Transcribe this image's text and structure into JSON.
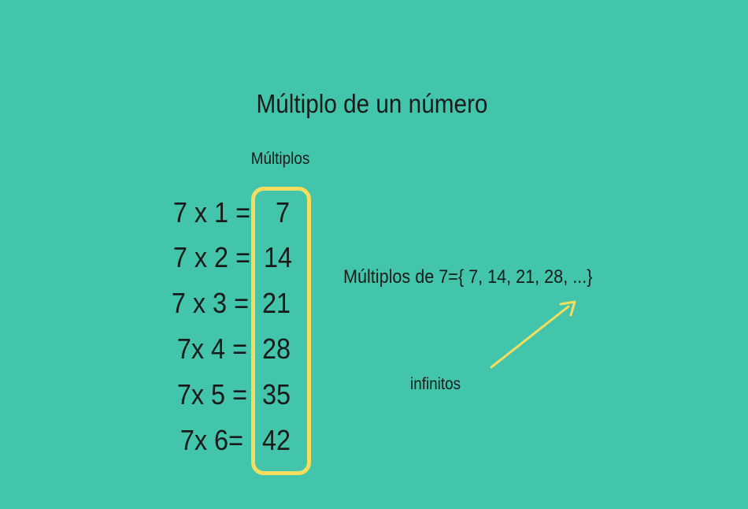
{
  "title": "Múltiplo de un número",
  "column_label": "Múltiplos",
  "rows": [
    {
      "expr": "7 x 1 =",
      "result": "7"
    },
    {
      "expr": "7 x 2 =",
      "result": "14"
    },
    {
      "expr": "7 x 3 =",
      "result": "21"
    },
    {
      "expr": "7x 4 =",
      "result": "28"
    },
    {
      "expr": "7x 5 =",
      "result": "35"
    },
    {
      "expr": "7x 6=",
      "result": "42"
    }
  ],
  "set_statement": "Múltiplos de 7={ 7, 14, 21, 28, ...}",
  "arrow_label": "infinitos",
  "colors": {
    "background": "#42c5aa",
    "highlight": "#f7dd5c",
    "text": "#1a1a1a"
  }
}
